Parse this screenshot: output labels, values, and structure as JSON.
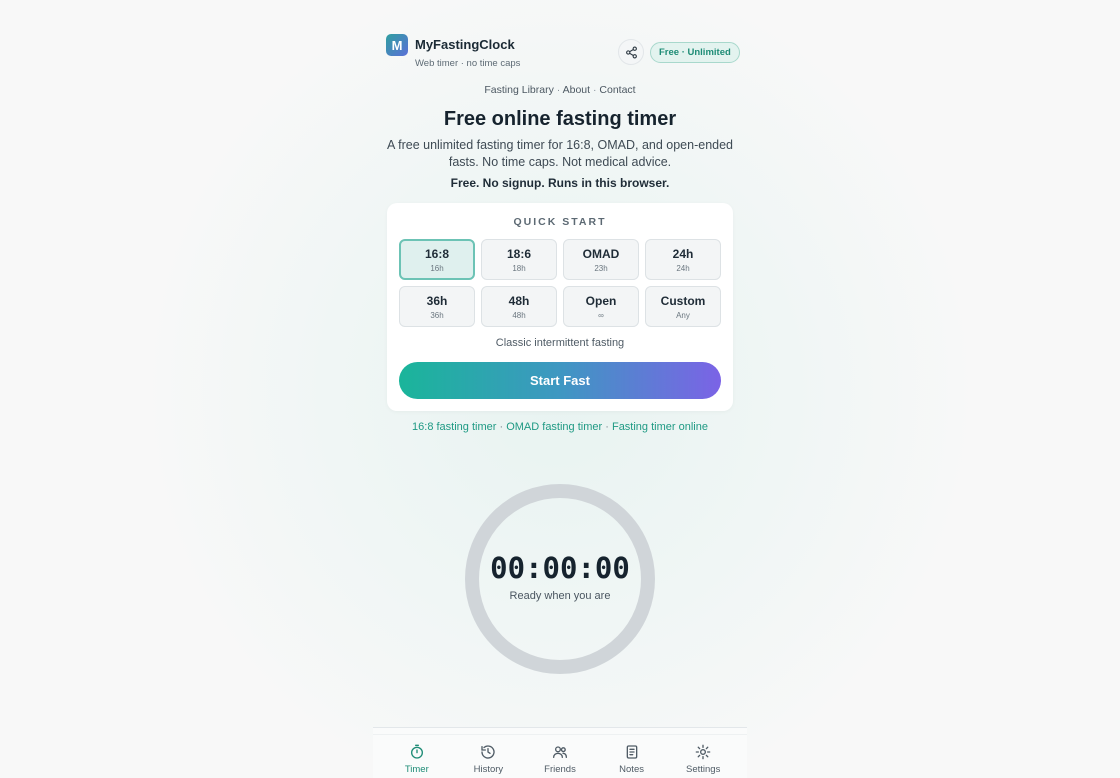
{
  "header": {
    "logo_letter": "M",
    "brand_name": "MyFastingClock",
    "brand_tagline": "Web timer · no time caps",
    "plan_badge": "Free · Unlimited"
  },
  "topnav": {
    "items": [
      "Fasting Library",
      "About",
      "Contact"
    ],
    "separator": "·"
  },
  "hero": {
    "title": "Free online fasting timer",
    "subtitle": "A free unlimited fasting timer for 16:8, OMAD, and open-ended fasts. No time caps. Not medical advice.",
    "tagline": "Free. No signup. Runs in this browser."
  },
  "quick_start": {
    "heading": "QUICK START",
    "presets": [
      {
        "name": "16:8",
        "sub": "16h",
        "active": true
      },
      {
        "name": "18:6",
        "sub": "18h",
        "active": false
      },
      {
        "name": "OMAD",
        "sub": "23h",
        "active": false
      },
      {
        "name": "24h",
        "sub": "24h",
        "active": false
      },
      {
        "name": "36h",
        "sub": "36h",
        "active": false
      },
      {
        "name": "48h",
        "sub": "48h",
        "active": false
      },
      {
        "name": "Open",
        "sub": "∞",
        "active": false
      },
      {
        "name": "Custom",
        "sub": "Any",
        "active": false
      }
    ],
    "description": "Classic intermittent fasting",
    "start_label": "Start Fast"
  },
  "seo_links": {
    "items": [
      "16:8 fasting timer",
      "OMAD fasting timer",
      "Fasting timer online"
    ],
    "separator": "·"
  },
  "timer": {
    "display": "00:00:00",
    "status": "Ready when you are"
  },
  "bottom_nav": {
    "items": [
      {
        "label": "Timer",
        "icon": "timer-icon",
        "active": true
      },
      {
        "label": "History",
        "icon": "history-icon",
        "active": false
      },
      {
        "label": "Friends",
        "icon": "friends-icon",
        "active": false
      },
      {
        "label": "Notes",
        "icon": "notes-icon",
        "active": false
      },
      {
        "label": "Settings",
        "icon": "settings-icon",
        "active": false
      }
    ]
  },
  "colors": {
    "accent": "#1e8c76",
    "button_gradient_start": "#1ab59a",
    "button_gradient_end": "#7b63e6",
    "ring": "#d0d5d9"
  }
}
